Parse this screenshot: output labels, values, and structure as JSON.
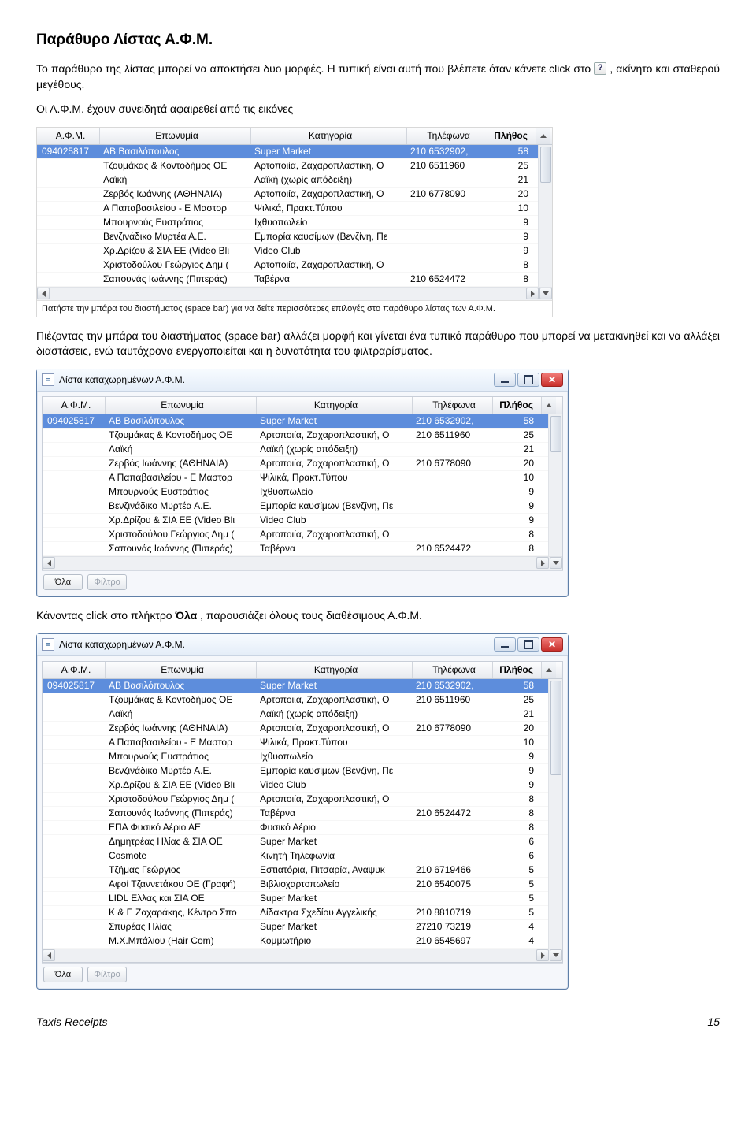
{
  "page": {
    "title": "Παράθυρο Λίστας Α.Φ.Μ.",
    "p1a": "Το παράθυρο της λίστας μπορεί να αποκτήσει δυο μορφές. Η τυπική είναι αυτή που βλέπετε όταν κάνετε click στο ",
    "p1b": ", ακίνητο και σταθερού μεγέθους.",
    "p2": "Οι Α.Φ.Μ. έχουν συνειδητά αφαιρεθεί από τις εικόνες",
    "p3": "Πιέζοντας την μπάρα του διαστήματος (space bar) αλλάζει μορφή και γίνεται ένα τυπικό παράθυρο που μπορεί να μετακινηθεί και να αλλάξει διαστάσεις, ενώ ταυτόχρονα ενεργοποιείται και η δυνατότητα του φιλτραρίσματος.",
    "p4a": "Κάνοντας click στο πλήκτρο ",
    "p4b": "Όλα",
    "p4c": ", παρουσιάζει όλους τους διαθέσιμους Α.Φ.Μ."
  },
  "headers": {
    "afm": "Α.Φ.Μ.",
    "name": "Επωνυμία",
    "cat": "Κατηγορία",
    "tel": "Τηλέφωνα",
    "cnt": "Πλήθος"
  },
  "rows10": [
    {
      "afm": "094025817",
      "name": "ΑΒ Βασιλόπουλος",
      "cat": "Super Market",
      "tel": "210 6532902,",
      "cnt": "58",
      "sel": true
    },
    {
      "afm": "",
      "name": "Τζουμάκας & Κοντοδήμος ΟΕ",
      "cat": "Αρτοποιία, Ζαχαροπλαστική, Ο",
      "tel": "210 6511960",
      "cnt": "25"
    },
    {
      "afm": "",
      "name": "Λαϊκή",
      "cat": "Λαϊκή (χωρίς απόδειξη)",
      "tel": "",
      "cnt": "21"
    },
    {
      "afm": "",
      "name": "Ζερβός Ιωάννης (ΑΘΗΝΑΙΑ)",
      "cat": "Αρτοποιία, Ζαχαροπλαστική, Ο",
      "tel": "210 6778090",
      "cnt": "20"
    },
    {
      "afm": "",
      "name": "Α Παπαβασιλείου - Ε Μαστορ",
      "cat": "Ψιλικά, Πρακτ.Τύπου",
      "tel": "",
      "cnt": "10"
    },
    {
      "afm": "",
      "name": "Μπουρνούς Ευστράτιος",
      "cat": "Ιχθυοπωλείο",
      "tel": "",
      "cnt": "9"
    },
    {
      "afm": "",
      "name": "Βενζινάδικο Μυρτέα Α.Ε.",
      "cat": "Εμπορία καυσίμων (Βενζίνη, Πε",
      "tel": "",
      "cnt": "9"
    },
    {
      "afm": "",
      "name": "Χρ.Δρίζου & ΣΙΑ ΕΕ (Video Blι",
      "cat": "Video Club",
      "tel": "",
      "cnt": "9"
    },
    {
      "afm": "",
      "name": "Χριστοδούλου  Γεώργιος Δημ (",
      "cat": "Αρτοποιία, Ζαχαροπλαστική, Ο",
      "tel": "",
      "cnt": "8"
    },
    {
      "afm": "",
      "name": "Σαπουνάς Ιωάννης (Πιπεράς)",
      "cat": "Ταβέρνα",
      "tel": "210 6524472",
      "cnt": "8"
    }
  ],
  "rows18": [
    {
      "afm": "094025817",
      "name": "ΑΒ Βασιλόπουλος",
      "cat": "Super Market",
      "tel": "210 6532902,",
      "cnt": "58",
      "sel": true
    },
    {
      "afm": "",
      "name": "Τζουμάκας & Κοντοδήμος ΟΕ",
      "cat": "Αρτοποιία, Ζαχαροπλαστική, Ο",
      "tel": "210 6511960",
      "cnt": "25"
    },
    {
      "afm": "",
      "name": "Λαϊκή",
      "cat": "Λαϊκή (χωρίς απόδειξη)",
      "tel": "",
      "cnt": "21"
    },
    {
      "afm": "",
      "name": "Ζερβός Ιωάννης (ΑΘΗΝΑΙΑ)",
      "cat": "Αρτοποιία, Ζαχαροπλαστική, Ο",
      "tel": "210 6778090",
      "cnt": "20"
    },
    {
      "afm": "",
      "name": "Α Παπαβασιλείου - Ε Μαστορ",
      "cat": "Ψιλικά, Πρακτ.Τύπου",
      "tel": "",
      "cnt": "10"
    },
    {
      "afm": "",
      "name": "Μπουρνούς Ευστράτιος",
      "cat": "Ιχθυοπωλείο",
      "tel": "",
      "cnt": "9"
    },
    {
      "afm": "",
      "name": "Βενζινάδικο Μυρτέα Α.Ε.",
      "cat": "Εμπορία καυσίμων (Βενζίνη, Πε",
      "tel": "",
      "cnt": "9"
    },
    {
      "afm": "",
      "name": "Χρ.Δρίζου & ΣΙΑ ΕΕ (Video Blι",
      "cat": "Video Club",
      "tel": "",
      "cnt": "9"
    },
    {
      "afm": "",
      "name": "Χριστοδούλου  Γεώργιος Δημ (",
      "cat": "Αρτοποιία, Ζαχαροπλαστική, Ο",
      "tel": "",
      "cnt": "8"
    },
    {
      "afm": "",
      "name": "Σαπουνάς Ιωάννης (Πιπεράς)",
      "cat": "Ταβέρνα",
      "tel": "210 6524472",
      "cnt": "8"
    },
    {
      "afm": "",
      "name": "ΕΠΑ Φυσικό Αέριο ΑΕ",
      "cat": "Φυσικό Αέριο",
      "tel": "",
      "cnt": "8"
    },
    {
      "afm": "",
      "name": "Δημητρέας Ηλίας & ΣΙΑ ΟΕ",
      "cat": "Super Market",
      "tel": "",
      "cnt": "6"
    },
    {
      "afm": "",
      "name": "Cosmote",
      "cat": "Κινητή Τηλεφωνία",
      "tel": "",
      "cnt": "6"
    },
    {
      "afm": "",
      "name": "Τζήμας Γεώργιος",
      "cat": "Εστιατόρια, Πιτσαρία, Αναψυκ",
      "tel": "210 6719466",
      "cnt": "5"
    },
    {
      "afm": "",
      "name": "Αφοί Τζαννετάκου ΟΕ (Γραφή)",
      "cat": "Βιβλιοχαρτοπωλείο",
      "tel": "210 6540075",
      "cnt": "5"
    },
    {
      "afm": "",
      "name": "LIDL Ελλας και ΣΙΑ ΟΕ",
      "cat": "Super Market",
      "tel": "",
      "cnt": "5"
    },
    {
      "afm": "",
      "name": "Κ & Ε Ζαχαράκης, Κέντρο Σπο",
      "cat": "Δίδακτρα Σχεδίου Αγγελικής",
      "tel": "210 8810719",
      "cnt": "5"
    },
    {
      "afm": "",
      "name": "Σπυρέας Ηλίας",
      "cat": "Super Market",
      "tel": "27210 73219",
      "cnt": "4"
    },
    {
      "afm": "",
      "name": "Μ.Χ.Μπάλιου (Hair Com)",
      "cat": "Κομμωτήριο",
      "tel": "210 6545697",
      "cnt": "4"
    }
  ],
  "grid1": {
    "status": "Πατήστε την μπάρα του διαστήματος (space bar) για να δείτε περισσότερες επιλογές στο παράθυρο λίστας των Α.Φ.Μ."
  },
  "win": {
    "title": "Λίστα καταχωρημένων Α.Φ.Μ.",
    "wicon": "≡"
  },
  "toolbar": {
    "all": "Όλα",
    "filter": "Φίλτρο"
  },
  "footer": {
    "name": "Taxis Receipts",
    "page": "15"
  }
}
